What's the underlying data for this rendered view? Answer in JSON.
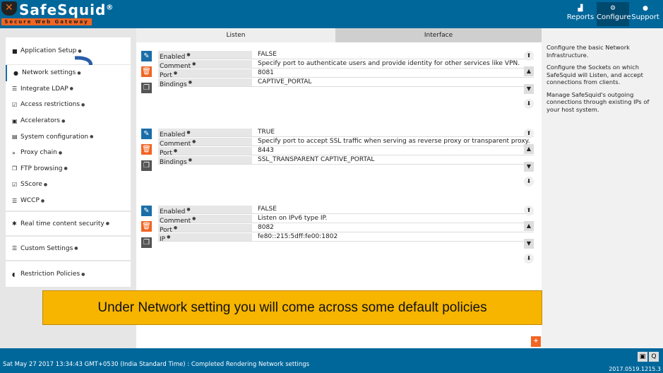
{
  "header": {
    "brand": "SafeSquid",
    "brand_mark": "®",
    "tagline": "Secure Web Gateway",
    "nav": [
      {
        "label": "Reports",
        "icon": "chart-icon"
      },
      {
        "label": "Configure",
        "icon": "cogs-icon",
        "active": true
      },
      {
        "label": "Support",
        "icon": "info-icon"
      }
    ]
  },
  "sidebar": {
    "group1": "Application Setup",
    "items": [
      {
        "label": "Network settings",
        "icon": "globe-icon",
        "active": true
      },
      {
        "label": "Integrate LDAP",
        "icon": "list-icon"
      },
      {
        "label": "Access restrictions",
        "icon": "check-square-icon"
      },
      {
        "label": "Accelerators",
        "icon": "train-icon"
      },
      {
        "label": "System configuration",
        "icon": "server-icon"
      },
      {
        "label": "Proxy chain",
        "icon": "forward-icon"
      },
      {
        "label": "FTP browsing",
        "icon": "copy-icon"
      },
      {
        "label": "SScore",
        "icon": "check-square-icon"
      },
      {
        "label": "WCCP",
        "icon": "list-icon"
      }
    ],
    "group2": "Real time content security",
    "group3": "Custom Settings",
    "group4": "Restriction Policies"
  },
  "tabs": [
    "Listen",
    "Interface"
  ],
  "records": [
    {
      "rows": [
        {
          "label": "Enabled",
          "value": "FALSE"
        },
        {
          "label": "Comment",
          "value": "Specify port to authenticate users and provide identity for other services like VPN."
        },
        {
          "label": "Port",
          "value": "8081"
        },
        {
          "label": "Bindings",
          "value": "CAPTIVE_PORTAL"
        }
      ]
    },
    {
      "rows": [
        {
          "label": "Enabled",
          "value": "TRUE"
        },
        {
          "label": "Comment",
          "value": "Specify port to accept SSL traffic when serving as reverse proxy or transparent proxy."
        },
        {
          "label": "Port",
          "value": "8443"
        },
        {
          "label": "Bindings",
          "value": "SSL_TRANSPARENT  CAPTIVE_PORTAL"
        }
      ]
    },
    {
      "rows": [
        {
          "label": "Enabled",
          "value": "FALSE"
        },
        {
          "label": "Comment",
          "value": "Listen on IPv6 type IP."
        },
        {
          "label": "Port",
          "value": "8082"
        },
        {
          "label": "IP",
          "value": "fe80::215:5dff:fe00:1802"
        }
      ]
    }
  ],
  "info": [
    "Configure the basic Network Infrastructure.",
    "Configure the Sockets on which SafeSquid will Listen, and accept connections from clients.",
    "Manage SafeSquid's outgoing connections through existing IPs of your host system."
  ],
  "banner": "Under Network setting you will come across some default policies",
  "footer": {
    "status": "Sat May 27 2017 13:34:43 GMT+0530 (India Standard Time) : Completed Rendering Network settings",
    "version": "2017.0519.1215.3"
  },
  "colors": {
    "header": "#00679b",
    "accent": "#f26522",
    "banner": "#f7b500",
    "edit": "#1a6ea8",
    "delete": "#f26522",
    "copy": "#555555"
  }
}
